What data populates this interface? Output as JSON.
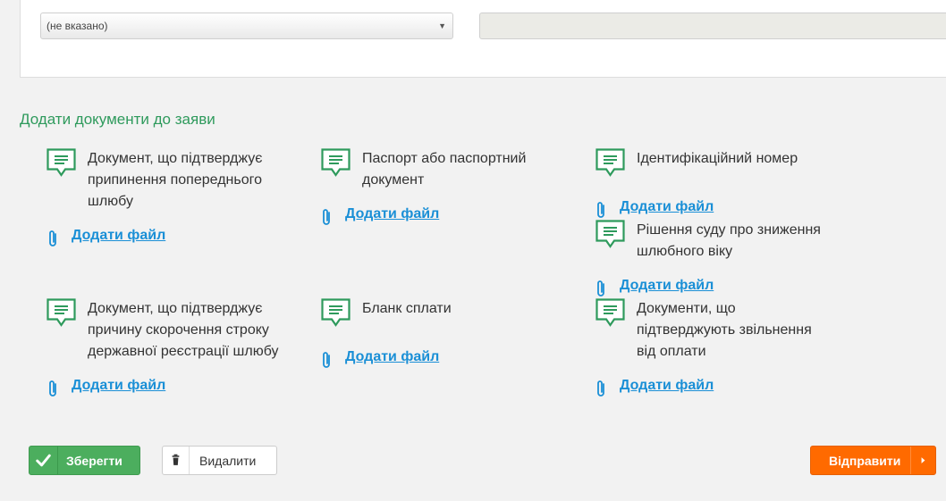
{
  "form": {
    "select_value": "(не вказано)"
  },
  "section": {
    "title": "Додати документи до заяви"
  },
  "documents": [
    {
      "label": "Документ, що підтверджує припинення попереднього шлюбу",
      "link": "Додати файл"
    },
    {
      "label": "Паспорт або паспортний документ",
      "link": "Додати файл"
    },
    {
      "label": "Ідентифікаційний номер",
      "link": "Додати файл"
    },
    {
      "label": "Рішення суду про зниження шлюбного віку",
      "link": "Додати файл"
    },
    {
      "label": "Документ, що підтверджує причину скорочення строку державної реєстрації шлюбу",
      "link": "Додати файл"
    },
    {
      "label": "Бланк сплати",
      "link": "Додати файл"
    },
    {
      "label": "Документи, що підтверджують звільнення від оплати",
      "link": "Додати файл"
    }
  ],
  "actions": {
    "save": "Зберегти",
    "delete": "Видалити",
    "send": "Відправити"
  },
  "colors": {
    "accent_green": "#2e9a5c",
    "link_blue": "#1a8fd6",
    "save_green": "#4cae5e",
    "send_orange": "#ff6a00"
  },
  "icons": {
    "document": "document-comment-icon",
    "attachment": "paperclip-icon",
    "save": "checkmark-icon",
    "delete": "trash-icon",
    "send": "caret-right-icon"
  }
}
